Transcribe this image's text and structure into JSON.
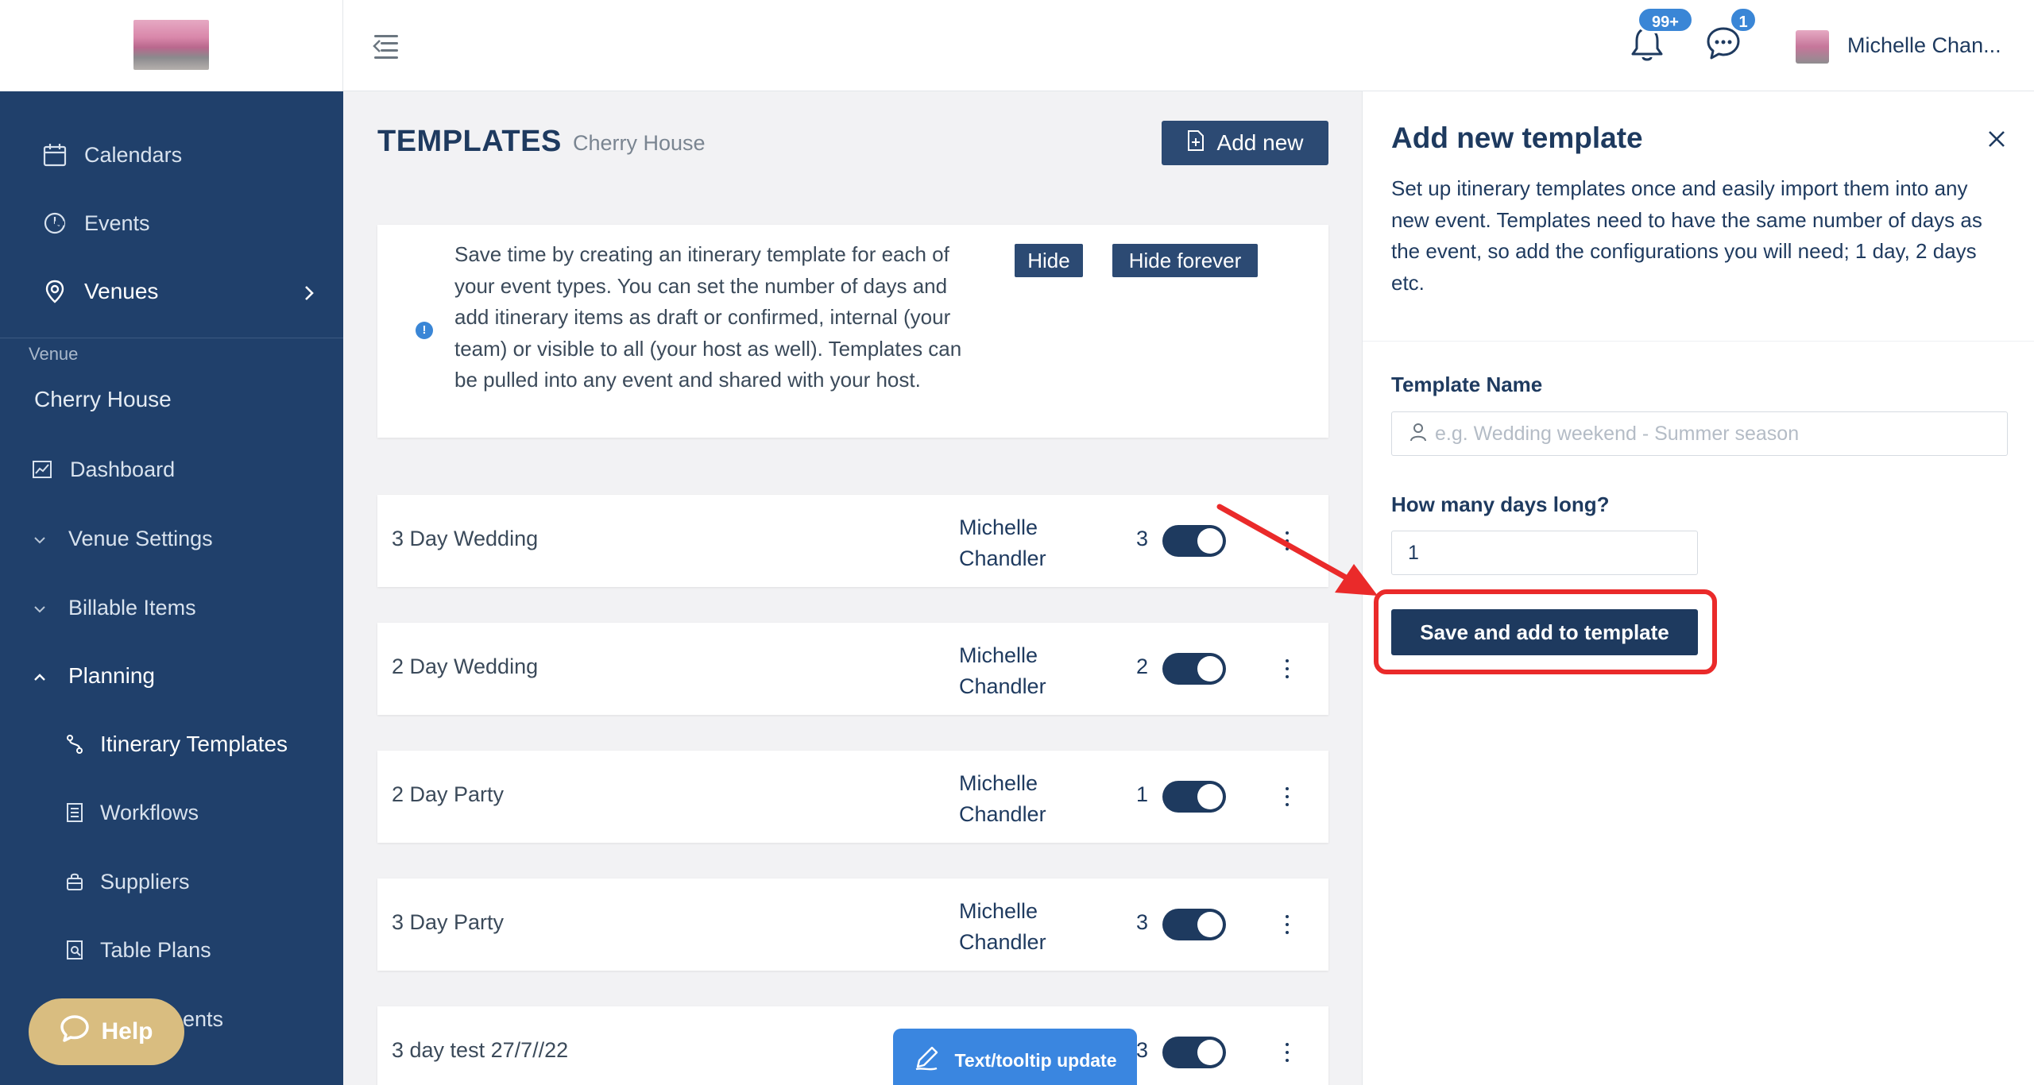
{
  "topbar": {
    "notifications_badge": "99+",
    "messages_badge": "1",
    "username": "Michelle Chan..."
  },
  "sidebar": {
    "top_items": [
      {
        "label": "Calendars",
        "icon": "calendar-icon"
      },
      {
        "label": "Events",
        "icon": "events-icon"
      },
      {
        "label": "Venues",
        "icon": "location-pin-icon"
      }
    ],
    "section_label": "Venue",
    "venue_name": "Cherry House",
    "items": [
      {
        "label": "Dashboard",
        "icon": "chart-icon"
      },
      {
        "label": "Venue Settings",
        "icon": "chevron-down-icon"
      },
      {
        "label": "Billable Items",
        "icon": "chevron-down-icon"
      },
      {
        "label": "Planning",
        "icon": "chevron-up-icon"
      },
      {
        "label": "Itinerary Templates",
        "icon": "route-icon"
      },
      {
        "label": "Workflows",
        "icon": "document-icon"
      },
      {
        "label": "Suppliers",
        "icon": "bag-icon"
      },
      {
        "label": "Table Plans",
        "icon": "table-plan-icon"
      },
      {
        "label": "ents",
        "icon": "none"
      }
    ],
    "help_label": "Help"
  },
  "main": {
    "title": "TEMPLATES",
    "subtitle": "Cherry House",
    "add_new_label": "Add new",
    "info": {
      "text": "Save time by creating an itinerary template for each of your event types. You can set the number of days and add itinerary items as draft or confirmed, internal (your team) or visible to all (your host as well). Templates can be pulled into any event and shared with your host.",
      "hide_label": "Hide",
      "hide_forever_label": "Hide forever"
    },
    "templates": [
      {
        "name": "3 Day Wedding",
        "owner": "Michelle Chandler",
        "days": "3",
        "enabled": true
      },
      {
        "name": "2 Day Wedding",
        "owner": "Michelle Chandler",
        "days": "2",
        "enabled": true
      },
      {
        "name": "2 Day Party",
        "owner": "Michelle Chandler",
        "days": "1",
        "enabled": true
      },
      {
        "name": "3 Day Party",
        "owner": "Michelle Chandler",
        "days": "3",
        "enabled": true
      },
      {
        "name": "3 day test 27/7//22",
        "owner": "",
        "days": "3",
        "enabled": true
      }
    ],
    "tooltip_update_label": "Text/tooltip update"
  },
  "panel": {
    "title": "Add new template",
    "description": "Set up itinerary templates once and easily import them into any new event. Templates need to have the same number of days as the event, so add the configurations you will need; 1 day, 2 days etc.",
    "template_name_label": "Template Name",
    "template_name_placeholder": "e.g. Wedding weekend - Summer season",
    "template_name_value": "",
    "days_label": "How many days long?",
    "days_value": "1",
    "save_label": "Save and add to template"
  },
  "colors": {
    "sidebar_bg": "#20406b",
    "primary": "#1e3a5f",
    "accent_blue": "#3a86d6",
    "help_gold": "#d9bd80",
    "highlight_red": "#ea2a2a"
  }
}
